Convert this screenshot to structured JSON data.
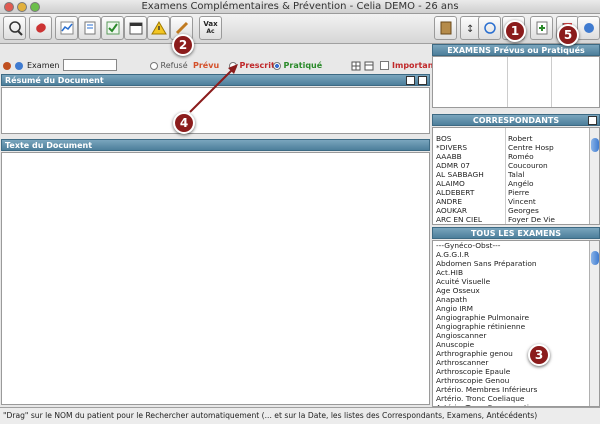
{
  "window": {
    "title": "Examens Complémentaires & Prévention - Celia DEMO - 26 ans"
  },
  "toolbar": {
    "icons": [
      "patient-icon",
      "pills-icon",
      "chart-icon",
      "document-icon",
      "checklist-icon",
      "calendar-icon",
      "alert-icon",
      "pen-icon",
      "vaccine-icon"
    ],
    "vax_label": "Vax",
    "vax_sub": "Ac"
  },
  "exam_bar": {
    "label": "Examen",
    "input_value": "",
    "options": [
      {
        "label": "Refusé",
        "color": "#555555",
        "selected": false
      },
      {
        "label": "Prévu",
        "color": "#d4502a",
        "selected": false
      },
      {
        "label": "Prescrit",
        "color": "#c0282a",
        "selected": false
      },
      {
        "label": "Pratiqué",
        "color": "#2a8a2a",
        "selected": true
      }
    ],
    "important_label": "Important"
  },
  "resume": {
    "title": "Résumé du Document"
  },
  "texte": {
    "title": "Texte du Document"
  },
  "prevus": {
    "title": "EXAMENS Prévus ou Pratiqués"
  },
  "correspondants": {
    "title": "CORRESPONDANTS",
    "rows": [
      {
        "name": "BOS",
        "first": "Robert"
      },
      {
        "name": "*DIVERS",
        "first": "Centre Hosp"
      },
      {
        "name": "AAABB",
        "first": "Roméo"
      },
      {
        "name": "ADMR 07",
        "first": "Coucouron"
      },
      {
        "name": "AL SABBAGH",
        "first": "Talal"
      },
      {
        "name": "ALAIMO",
        "first": "Angélo"
      },
      {
        "name": "ALDEBERT",
        "first": "Pierre"
      },
      {
        "name": "ANDRE",
        "first": "Vincent"
      },
      {
        "name": "AOUKAR",
        "first": "Georges"
      },
      {
        "name": "ARC EN CIEL",
        "first": "Foyer De Vie"
      }
    ]
  },
  "tous": {
    "title": "TOUS LES EXAMENS",
    "items": [
      "---Gynéco-Obst---",
      "A.G.G.I.R",
      "Abdomen Sans Préparation",
      "Act.HIB",
      "Acuité Visuelle",
      "Age Osseux",
      "Anapath",
      "Angio IRM",
      "Angiographie Pulmonaire",
      "Angiographie rétinienne",
      "Angioscanner",
      "Anuscopie",
      "Arthrographie genou",
      "Arthroscanner",
      "Arthroscopie Epaule",
      "Arthroscopie Genou",
      "Artério. Membres Inférieurs",
      "Artério. Tronc Coeliaque",
      "Artério. Tronc Supra-aortiques"
    ]
  },
  "status": {
    "text": "\"Drag\" sur le NOM du patient pour le Rechercher automatiquement (... et sur la Date, les listes des Correspondants, Examens, Antécédents)"
  },
  "callouts": [
    "1",
    "2",
    "3",
    "4",
    "5"
  ]
}
